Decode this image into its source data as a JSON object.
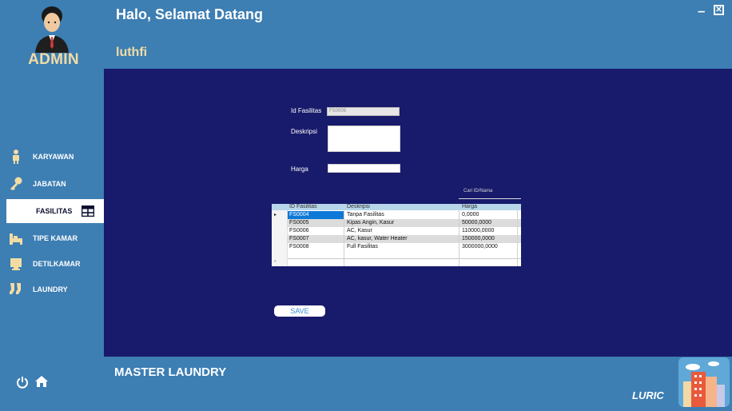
{
  "header": {
    "title": "Halo, Selamat Datang",
    "user": "luthfi"
  },
  "sidebar": {
    "role": "ADMIN",
    "items": [
      {
        "label": "KARYAWAN",
        "icon": "person-icon"
      },
      {
        "label": "JABATAN",
        "icon": "key-icon"
      },
      {
        "label": "FASILITAS",
        "icon": "table-icon",
        "active": true
      },
      {
        "label": "TIPE KAMAR",
        "icon": "bed-icon"
      },
      {
        "label": "DETILKAMAR",
        "icon": "monitor-icon"
      },
      {
        "label": "LAUNDRY",
        "icon": "socks-icon"
      }
    ]
  },
  "window": {
    "minimize": "–",
    "close": "✕"
  },
  "form": {
    "id_label": "Id Fasilitas",
    "id_value": "FS0009",
    "desc_label": "Deskripsi",
    "desc_value": "",
    "price_label": "Harga",
    "price_value": "",
    "search_placeholder": "Cari ID/Nama",
    "save_label": "SAVE"
  },
  "table": {
    "columns": [
      "ID Fasilitas",
      "Deskripsi",
      "Harga"
    ],
    "rows": [
      [
        "FS0004",
        "Tanpa Fasilitas",
        "0,0000"
      ],
      [
        "FS0005",
        "Kipas Angin, Kasur",
        "50000,0000"
      ],
      [
        "FS0006",
        "AC, Kasur",
        "110000,0000"
      ],
      [
        "FS0007",
        "AC, kasur, Water Heater",
        "150000,0000"
      ],
      [
        "FS0008",
        "Full Fasilitas",
        "3000000,0000"
      ]
    ],
    "row_marker": "▸",
    "new_row_marker": "*"
  },
  "footer": {
    "title": "MASTER LAUNDRY",
    "brand": "LURIC"
  },
  "colors": {
    "background": "#3d7eb3",
    "panel": "#181a6b",
    "accent": "#f2dca4"
  }
}
